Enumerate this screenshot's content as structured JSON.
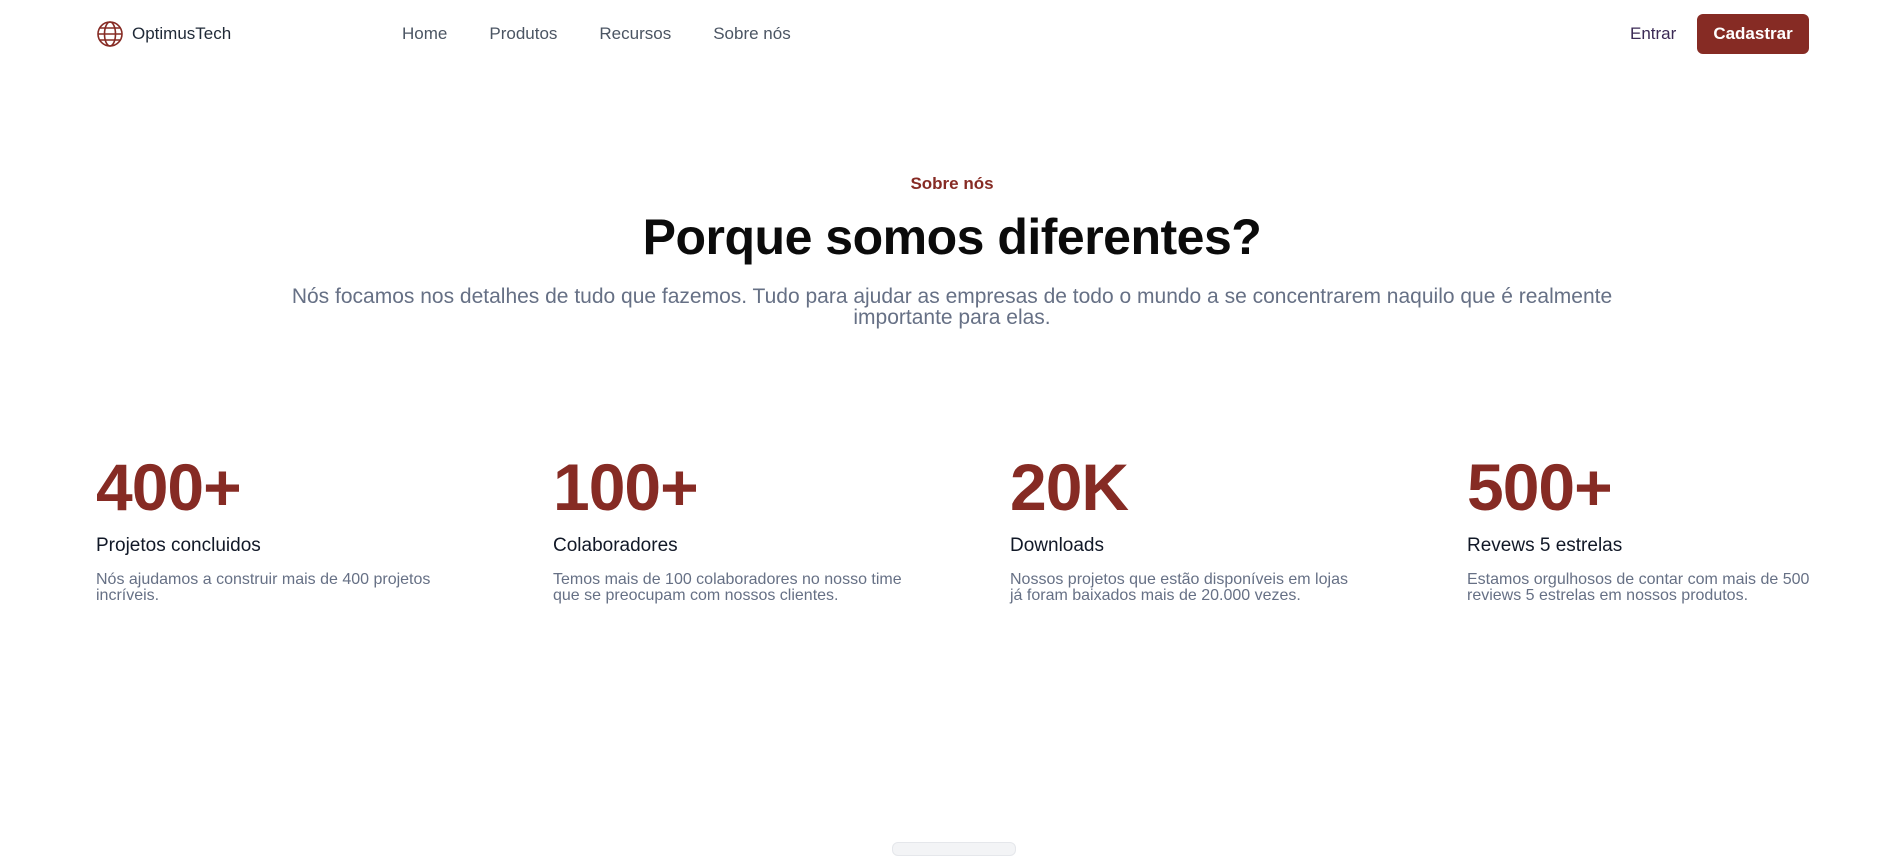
{
  "brand": {
    "name": "OptimusTech",
    "icon": "globe-icon"
  },
  "nav": {
    "links": [
      "Home",
      "Produtos",
      "Recursos",
      "Sobre nós"
    ]
  },
  "auth": {
    "login_label": "Entrar",
    "signup_label": "Cadastrar"
  },
  "hero": {
    "eyebrow": "Sobre nós",
    "title": "Porque somos diferentes?",
    "subtitle": "Nós focamos nos detalhes de tudo que fazemos. Tudo para ajudar as empresas de todo o mundo a se concentrarem naquilo que é realmente importante para elas."
  },
  "stats": [
    {
      "value": "400+",
      "label": "Projetos concluidos",
      "description": "Nós ajudamos a construir mais de 400 projetos incríveis."
    },
    {
      "value": "100+",
      "label": "Colaboradores",
      "description": "Temos mais de 100 colaboradores no nosso time que se preocupam com nossos clientes."
    },
    {
      "value": "20K",
      "label": "Downloads",
      "description": "Nossos projetos que estão disponíveis em lojas já foram baixados mais de 20.000 vezes."
    },
    {
      "value": "500+",
      "label": "Revews 5 estrelas",
      "description": "Estamos orgulhosos de contar com mais de 500 reviews 5 estrelas em nossos produtos."
    }
  ],
  "colors": {
    "accent": "#862b24",
    "muted_text": "#667085",
    "heading": "#0b0b0b"
  }
}
